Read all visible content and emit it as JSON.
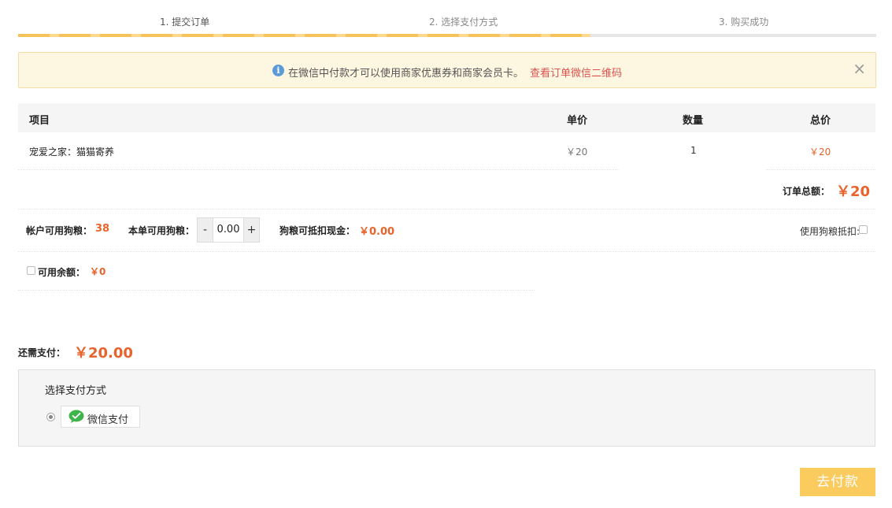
{
  "steps": {
    "items": [
      "1. 提交订单",
      "2. 选择支付方式",
      "3. 购买成功"
    ],
    "progress_fraction": 0.667
  },
  "notice": {
    "message": "在微信中付款才可以使用商家优惠券和商家会员卡。",
    "link": "查看订单微信二维码",
    "close": "×",
    "icon": "info-icon"
  },
  "table": {
    "headers": {
      "item": "项目",
      "price": "单价",
      "qty": "数量",
      "total": "总价"
    },
    "rows": [
      {
        "item": "宠爱之家：猫猫寄养",
        "price": "￥20",
        "qty": "1",
        "total": "￥20"
      }
    ]
  },
  "order_total": {
    "label": "订单总额：",
    "value": "￥20"
  },
  "points": {
    "available_label": "帐户可用狗粮：",
    "available_value": "38",
    "this_order_label": "本单可用狗粮：",
    "minus": "-",
    "plus": "+",
    "input_value": "0.00",
    "deduct_cash_label": "狗粮可抵扣现金：",
    "deduct_cash_value": "￥0.00",
    "use_deduct_label": "使用狗粮抵扣:"
  },
  "balance": {
    "label": "可用余额：",
    "value": "￥0"
  },
  "remaining": {
    "label": "还需支付：",
    "value": "￥20.00"
  },
  "payment": {
    "title": "选择支付方式",
    "options": [
      {
        "label": "微信支付",
        "icon": "wechat-icon"
      }
    ]
  },
  "go_pay": "去付款",
  "colors": {
    "accent": "#e8632b",
    "button": "#fbcb5e",
    "progress": "#f6c35a"
  }
}
